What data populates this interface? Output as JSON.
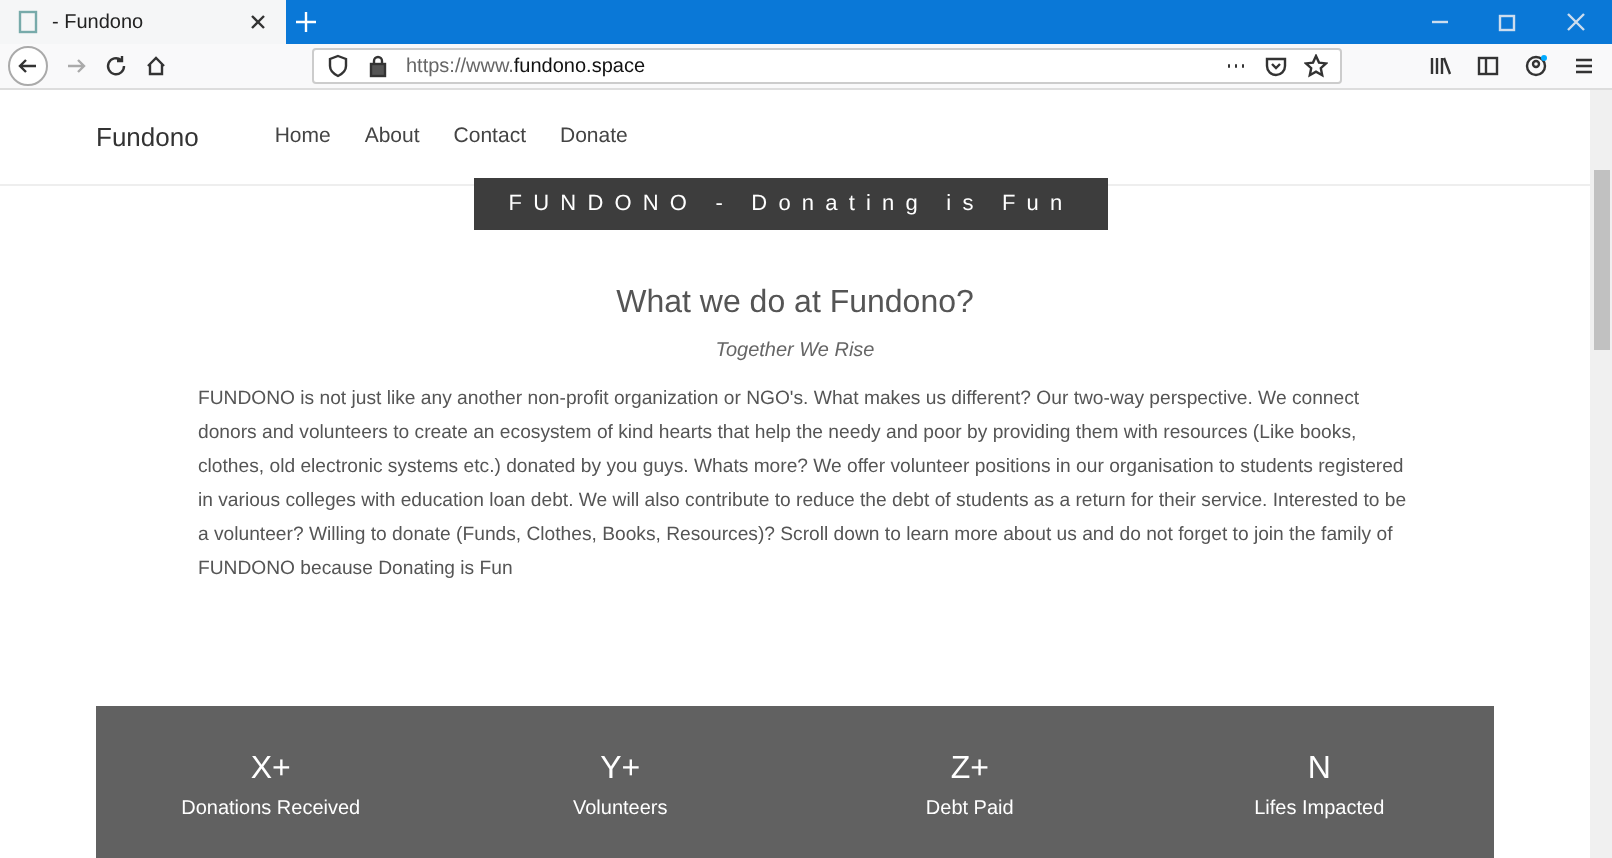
{
  "browser": {
    "tab": {
      "title": "- Fundono",
      "selected": true
    },
    "url_prefix": "https://www.",
    "url_domain": "fundono.space"
  },
  "site": {
    "brand": "Fundono",
    "nav": [
      {
        "label": "Home"
      },
      {
        "label": "About"
      },
      {
        "label": "Contact"
      },
      {
        "label": "Donate"
      }
    ],
    "banner": "FUNDONO - Donating is Fun",
    "heading": "What we do at Fundono?",
    "subtitle": "Together We Rise",
    "paragraph": "FUNDONO is not just like any another non-profit organization or NGO's. What makes us different? Our two-way perspective. We connect donors and volunteers to create an ecosystem of kind hearts that help the needy and poor by providing them with resources (Like books, clothes, old electronic systems etc.) donated by you guys. Whats more? We offer volunteer positions in our organisation to students registered in various colleges with education loan debt. We will also contribute to reduce the debt of students as a return for their service. Interested to be a volunteer? Willing to donate (Funds, Clothes, Books, Resources)? Scroll down to learn more about us and do not forget to join the family of FUNDONO because Donating is Fun",
    "stats": [
      {
        "value": "X+",
        "label": "Donations Received"
      },
      {
        "value": "Y+",
        "label": "Volunteers"
      },
      {
        "value": "Z+",
        "label": "Debt Paid"
      },
      {
        "value": "N",
        "label": "Lifes Impacted"
      }
    ]
  }
}
